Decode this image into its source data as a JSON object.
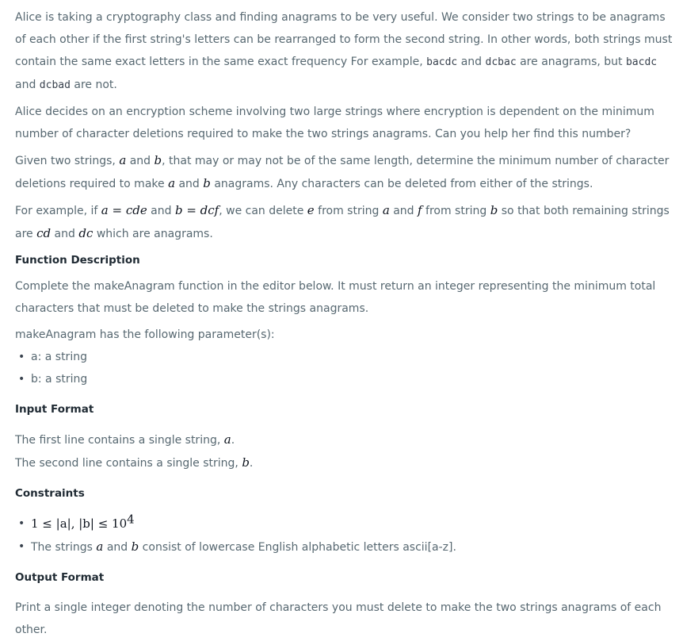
{
  "intro": {
    "p1_a": "Alice is taking a cryptography class and finding anagrams to be very useful. We consider two strings to be anagrams of each other if the first string's letters can be rearranged to form the second string. In other words, both strings must contain the same exact letters in the same exact frequency For example, ",
    "code1": "bacdc",
    "and1": " and ",
    "code2": "dcbac",
    "p1_b": " are anagrams, but ",
    "code3": "bacdc",
    "and2": " and ",
    "code4": "dcbad",
    "p1_c": " are not.",
    "p2": "Alice decides on an encryption scheme involving two large strings where encryption is dependent on the minimum number of character deletions required to make the two strings anagrams. Can you help her find this number?",
    "p3_a": "Given two strings, ",
    "p3_var_a": "a",
    "p3_and": " and ",
    "p3_var_b": "b",
    "p3_b": ", that may or may not be of the same length, determine the minimum number of character deletions required to make ",
    "p3_var_a2": "a",
    "p3_and2": " and ",
    "p3_var_b2": "b",
    "p3_c": " anagrams. Any characters can be deleted from either of the strings.",
    "p4_a": "For example, if ",
    "p4_eq1": "a = cde",
    "p4_and": " and ",
    "p4_eq2": "b = dcf",
    "p4_b": ", we can delete ",
    "p4_e": "e",
    "p4_c": " from string ",
    "p4_a_var": "a",
    "p4_and2": " and ",
    "p4_f": "f",
    "p4_d": " from string ",
    "p4_b_var": "b",
    "p4_e2": " so that both remaining strings are ",
    "p4_cd": "cd",
    "p4_and3": " and ",
    "p4_dc": "dc",
    "p4_end": " which are anagrams."
  },
  "function_description": {
    "heading": "Function Description",
    "text": "Complete the makeAnagram function in the editor below. It must return an integer representing the minimum total characters that must be deleted to make the strings anagrams.",
    "params_intro": "makeAnagram has the following parameter(s):",
    "params": [
      "a: a string",
      "b: a string"
    ]
  },
  "input_format": {
    "heading": "Input Format",
    "line1_a": "The first line contains a single string, ",
    "line1_var": "a",
    "line1_end": ".",
    "line2_a": "The second line contains a single string, ",
    "line2_var": "b",
    "line2_end": "."
  },
  "constraints": {
    "heading": "Constraints",
    "c1_math": "1 ≤ |a|, |b| ≤ 10",
    "c1_exp": "4",
    "c2_a": "The strings ",
    "c2_var_a": "a",
    "c2_and": " and ",
    "c2_var_b": "b",
    "c2_b": " consist of lowercase English alphabetic letters ascii[a-z]."
  },
  "output_format": {
    "heading": "Output Format",
    "text": "Print a single integer denoting the number of characters you must delete to make the two strings anagrams of each other."
  },
  "bullet_glyph": "•"
}
